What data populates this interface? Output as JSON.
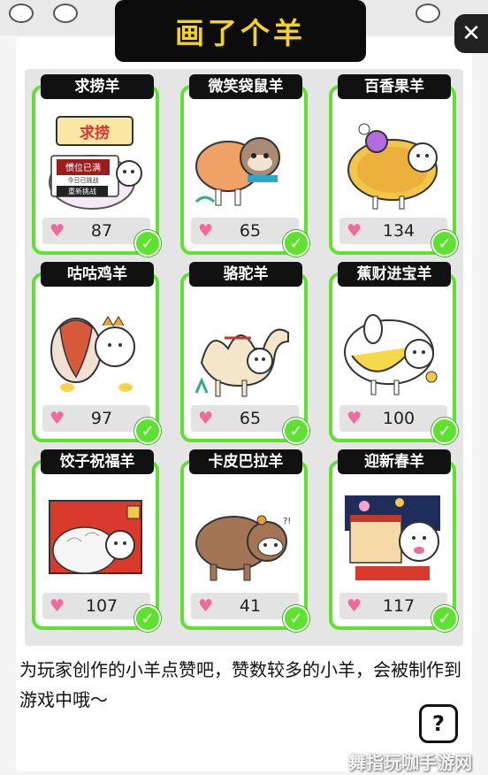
{
  "title": "画了个羊",
  "close_label": "✕",
  "items": [
    {
      "name": "求捞羊",
      "likes": "87",
      "liked": true
    },
    {
      "name": "微笑袋鼠羊",
      "likes": "65",
      "liked": true
    },
    {
      "name": "百香果羊",
      "likes": "134",
      "liked": true
    },
    {
      "name": "咕咕鸡羊",
      "likes": "97",
      "liked": true
    },
    {
      "name": "骆驼羊",
      "likes": "65",
      "liked": true
    },
    {
      "name": "蕉财进宝羊",
      "likes": "100",
      "liked": true
    },
    {
      "name": "饺子祝福羊",
      "likes": "107",
      "liked": true
    },
    {
      "name": "卡皮巴拉羊",
      "likes": "41",
      "liked": true
    },
    {
      "name": "迎新春羊",
      "likes": "117",
      "liked": true
    }
  ],
  "art_text": {
    "sign": "求捞",
    "board_line1": "惯位已满",
    "board_line2": "今日已挑战",
    "retry": "重新挑战",
    "qq": "?!"
  },
  "heart_icon": "♥",
  "check_icon": "✓",
  "description": "为玩家创作的小羊点赞吧，赞数较多的小羊，会被制作到游戏中哦～",
  "help_label": "?",
  "watermark": "舞指玩咖手游网",
  "colors": {
    "accent_green": "#5ee12f",
    "banner_text": "#f6d31a",
    "heart": "#f06a9b"
  }
}
